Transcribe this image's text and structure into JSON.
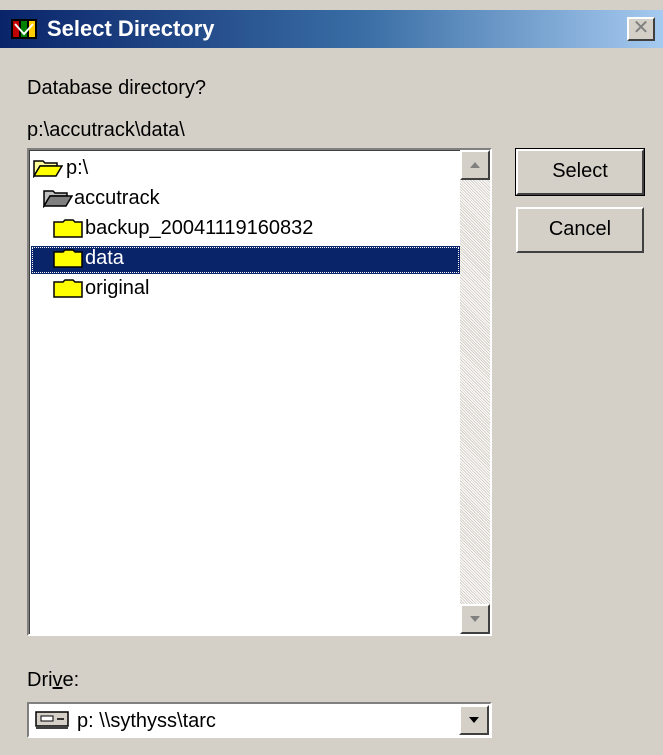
{
  "window": {
    "title": "Select Directory",
    "close_glyph": "✕"
  },
  "prompt": "Database directory?",
  "current_path": "p:\\accutrack\\data\\",
  "tree": {
    "items": [
      {
        "label": "p:\\",
        "icon": "open-folder-icon",
        "selected": false
      },
      {
        "label": "accutrack",
        "icon": "open-folder-icon",
        "selected": false
      },
      {
        "label": "backup_20041119160832",
        "icon": "folder-icon",
        "selected": false
      },
      {
        "label": "data",
        "icon": "folder-icon",
        "selected": true
      },
      {
        "label": "original",
        "icon": "folder-icon",
        "selected": false
      }
    ]
  },
  "buttons": {
    "select_label": "Select",
    "cancel_label": "Cancel"
  },
  "drive": {
    "label_pre": "Dri",
    "label_underlined": "v",
    "label_post": "e:",
    "selected_value": "p: \\\\sythyss\\tarc",
    "icon": "network-drive-icon"
  },
  "colors": {
    "selection": "#0a246a",
    "dialog_bg": "#d4d0c8",
    "folder_yellow": "#ffff00"
  }
}
